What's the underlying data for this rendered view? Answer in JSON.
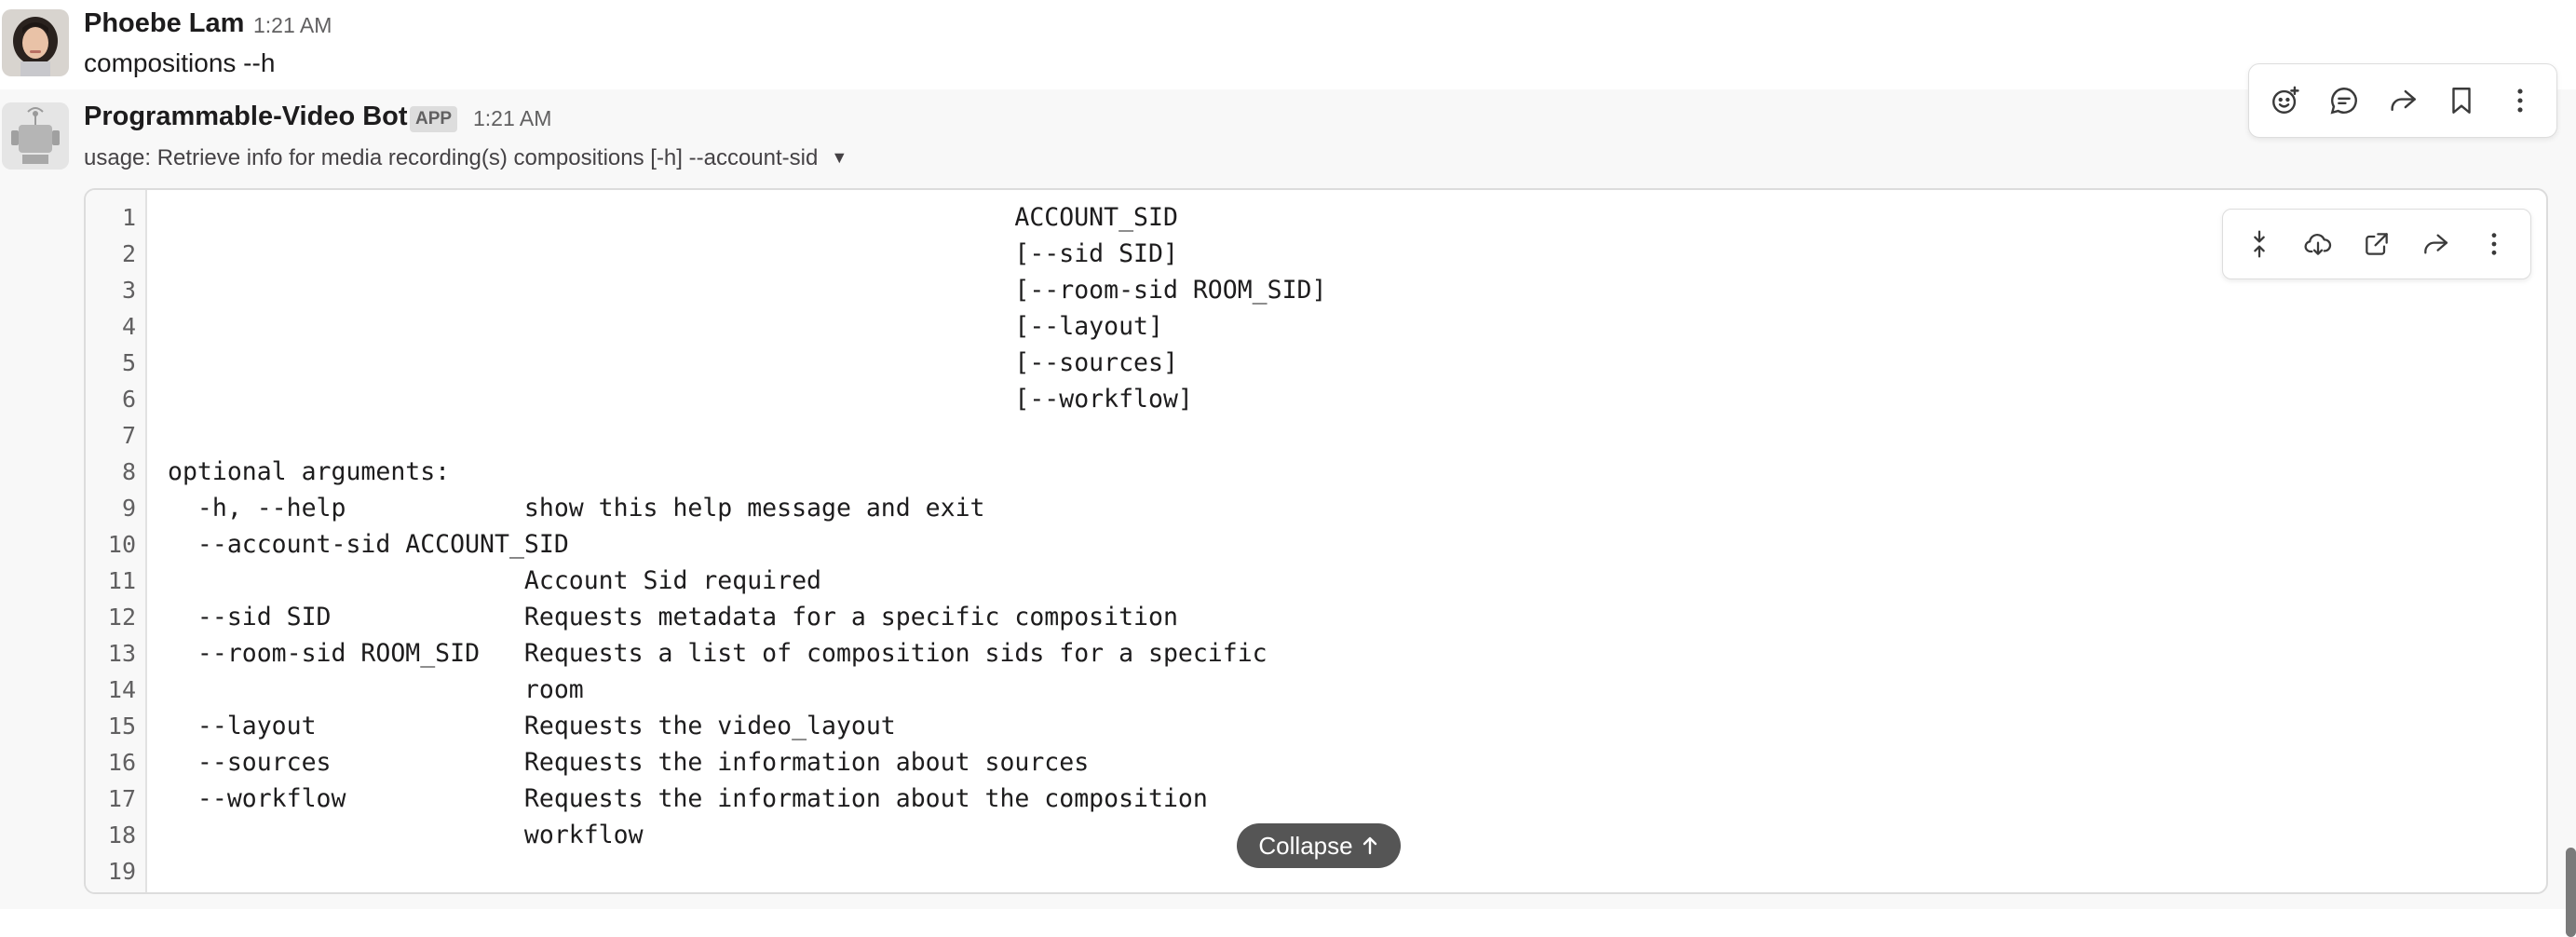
{
  "messages": [
    {
      "sender": "Phoebe Lam",
      "time": "1:21 AM",
      "text": "compositions --h"
    },
    {
      "sender": "Programmable-Video Bot",
      "badge": "APP",
      "time": "1:21 AM",
      "usage": "usage: Retrieve info for media recording(s) compositions [-h] --account-sid",
      "code": {
        "line_numbers": [
          "1",
          "2",
          "3",
          "4",
          "5",
          "6",
          "7",
          "8",
          "9",
          "10",
          "11",
          "12",
          "13",
          "14",
          "15",
          "16",
          "17",
          "18",
          "19"
        ],
        "lines": [
          "                                                         ACCOUNT_SID",
          "                                                         [--sid SID]",
          "                                                         [--room-sid ROOM_SID]",
          "                                                         [--layout]",
          "                                                         [--sources]",
          "                                                         [--workflow]",
          "",
          "optional arguments:",
          "  -h, --help            show this help message and exit",
          "  --account-sid ACCOUNT_SID",
          "                        Account Sid required",
          "  --sid SID             Requests metadata for a specific composition",
          "  --room-sid ROOM_SID   Requests a list of composition sids for a specific",
          "                        room",
          "  --layout              Requests the video_layout",
          "  --sources             Requests the information about sources",
          "  --workflow            Requests the information about the composition",
          "                        workflow",
          ""
        ],
        "collapse_label": "Collapse"
      }
    }
  ],
  "message_actions": [
    "add-reaction-icon",
    "reply-in-thread-icon",
    "share-icon",
    "bookmark-icon",
    "more-actions-icon"
  ],
  "code_actions": [
    "collapse-lines-icon",
    "download-icon",
    "open-external-icon",
    "share-icon",
    "more-actions-icon"
  ],
  "colors": {
    "hover_bg": "#f8f8f8",
    "collapse_bg": "#555555",
    "text": "#1d1c1d",
    "muted": "#616061"
  }
}
